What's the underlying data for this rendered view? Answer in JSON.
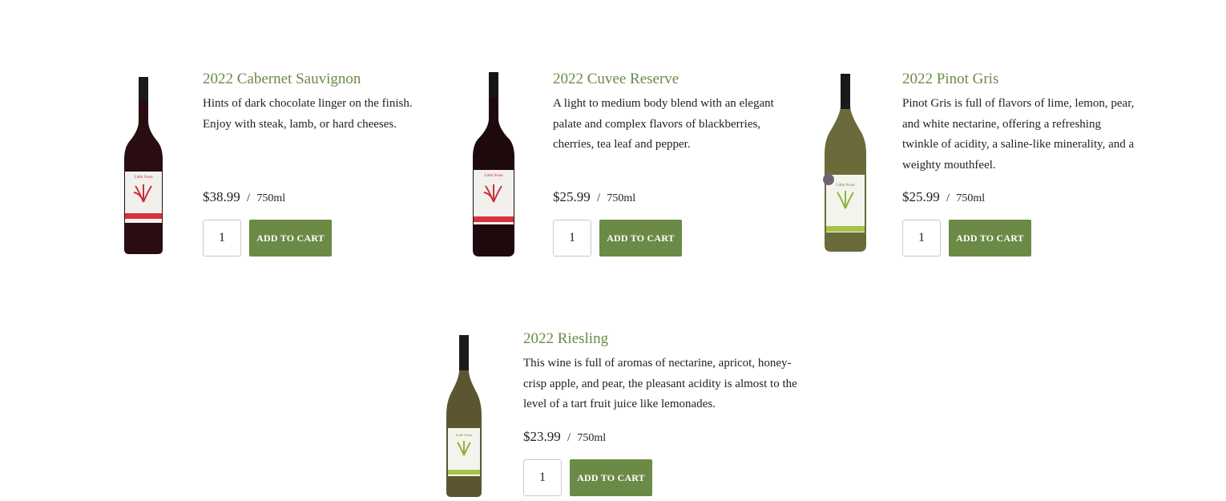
{
  "products": [
    {
      "title": "2022 Cabernet Sauvignon",
      "description": "Hints of dark chocolate linger on the finish. Enjoy with steak, lamb, or hard cheeses.",
      "price": "$38.99",
      "separator": "/",
      "unit": "750ml",
      "quantity": "1",
      "button": "ADD TO CART",
      "bottle": {
        "glass": "#2a0d10",
        "label": "#f2f0ec",
        "accent": "#d8323e",
        "label_text": "Little Swan"
      }
    },
    {
      "title": "2022 Cuvee Reserve",
      "description": "A light to medium body blend with an elegant palate and complex flavors of blackberries, cherries, tea leaf and pepper.",
      "price": "$25.99",
      "separator": "/",
      "unit": "750ml",
      "quantity": "1",
      "button": "ADD TO CART",
      "bottle": {
        "glass": "#1e0a0d",
        "label": "#f2f0ec",
        "accent": "#d8323e",
        "label_text": "Little Swan"
      }
    },
    {
      "title": "2022 Pinot Gris",
      "description": "Pinot Gris is full of flavors of lime, lemon, pear, and white nectarine, offering a refreshing twinkle of acidity, a saline-like minerality, and a weighty mouthfeel.",
      "price": "$25.99",
      "separator": "/",
      "unit": "750ml",
      "quantity": "1",
      "button": "ADD TO CART",
      "bottle": {
        "glass": "#6b6a3a",
        "label": "#f4f3ec",
        "accent": "#a8c24a",
        "label_text": "Little Swan"
      }
    },
    {
      "title": "2022 Riesling",
      "description": "This wine is full of aromas of nectarine, apricot, honey-crisp apple, and pear, the pleasant acidity is almost to the level of a tart fruit juice like lemonades.",
      "price": "$23.99",
      "separator": "/",
      "unit": "750ml",
      "quantity": "1",
      "button": "ADD TO CART",
      "bottle": {
        "glass": "#5c5630",
        "label": "#f4f3ec",
        "accent": "#a8c24a",
        "label_text": "Little Swan"
      }
    }
  ],
  "colors": {
    "accent_green": "#6b8a46",
    "text": "#222222",
    "background": "#ffffff"
  }
}
